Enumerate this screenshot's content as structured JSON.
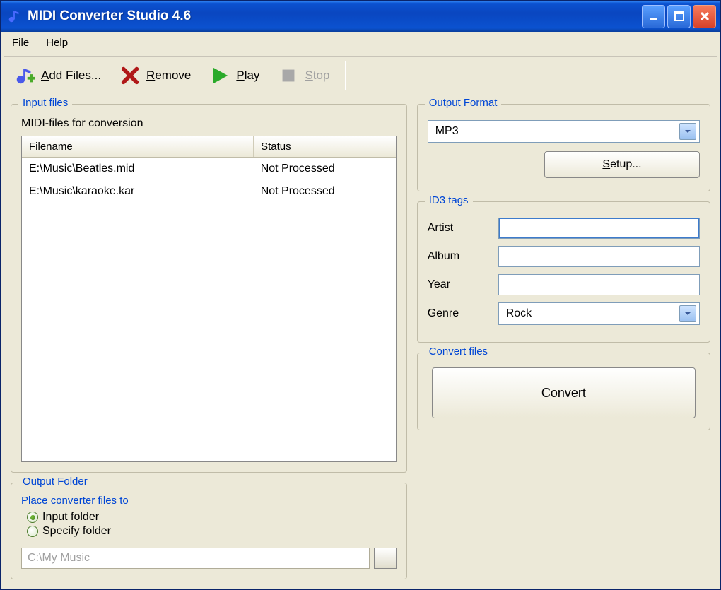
{
  "window": {
    "title": "MIDI Converter Studio 4.6"
  },
  "menu": {
    "file": "File",
    "help": "Help"
  },
  "toolbar": {
    "add_files": "Add Files...",
    "remove": "Remove",
    "play": "Play",
    "stop": "Stop"
  },
  "input_files": {
    "group_title": "Input files",
    "subtitle": "MIDI-files for conversion",
    "columns": {
      "filename": "Filename",
      "status": "Status"
    },
    "rows": [
      {
        "filename": "E:\\Music\\Beatles.mid",
        "status": "Not Processed"
      },
      {
        "filename": "E:\\Music\\karaoke.kar",
        "status": "Not Processed"
      }
    ]
  },
  "output_folder": {
    "group_title": "Output Folder",
    "subtitle": "Place converter files to",
    "option_input": "Input folder",
    "option_specify": "Specify folder",
    "path_value": "C:\\My Music"
  },
  "output_format": {
    "group_title": "Output Format",
    "selected": "MP3",
    "setup_label": "Setup..."
  },
  "id3": {
    "group_title": "ID3 tags",
    "artist_label": "Artist",
    "album_label": "Album",
    "year_label": "Year",
    "genre_label": "Genre",
    "artist_value": "",
    "album_value": "",
    "year_value": "",
    "genre_value": "Rock"
  },
  "convert": {
    "group_title": "Convert files",
    "button_label": "Convert"
  }
}
